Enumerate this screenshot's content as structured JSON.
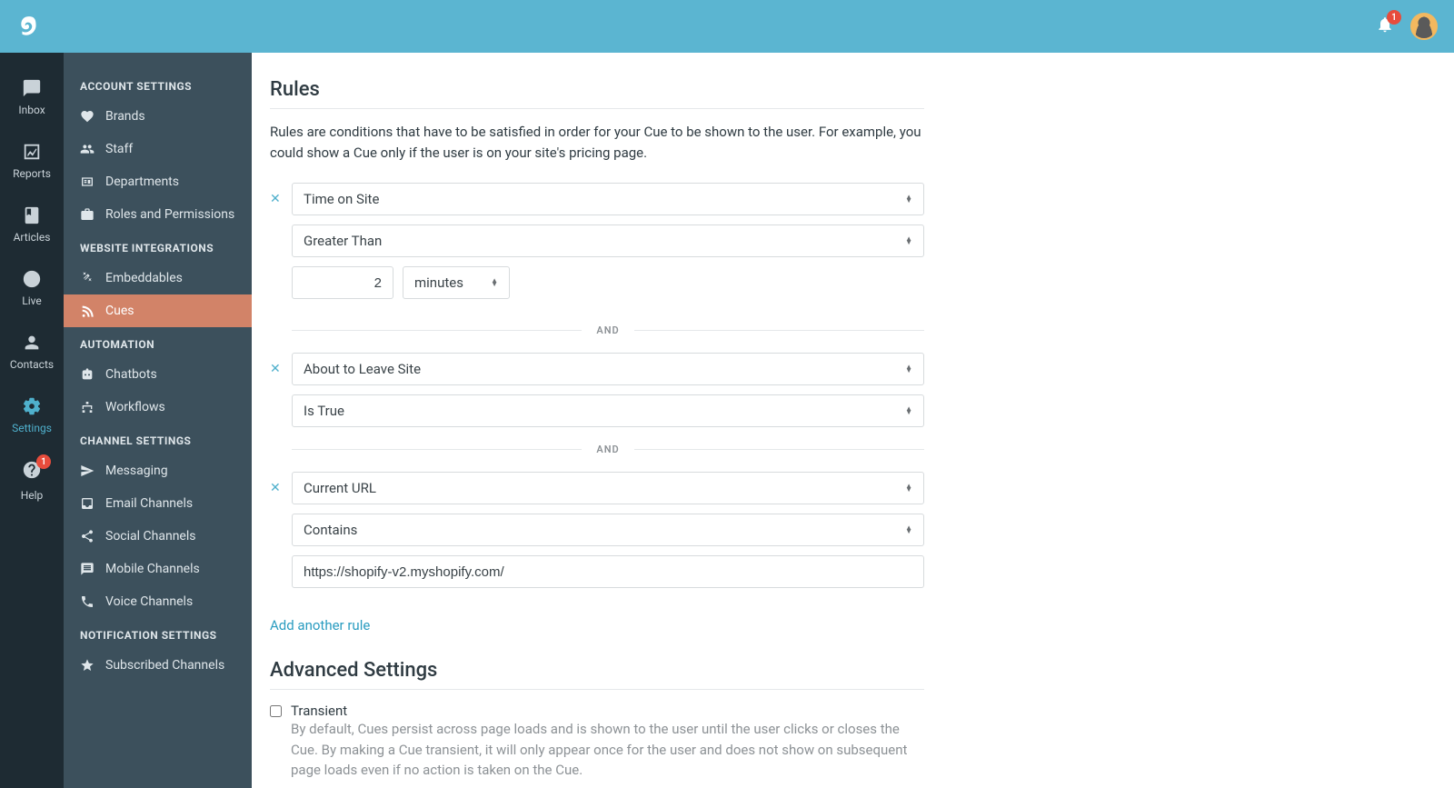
{
  "topbar": {
    "notification_count": "1"
  },
  "rail": {
    "inbox": "Inbox",
    "reports": "Reports",
    "articles": "Articles",
    "live": "Live",
    "contacts": "Contacts",
    "settings": "Settings",
    "help": "Help",
    "help_badge": "1"
  },
  "subnav": {
    "account_settings": "ACCOUNT SETTINGS",
    "brands": "Brands",
    "staff": "Staff",
    "departments": "Departments",
    "roles": "Roles and Permissions",
    "website_integrations": "WEBSITE INTEGRATIONS",
    "embeddables": "Embeddables",
    "cues": "Cues",
    "automation": "AUTOMATION",
    "chatbots": "Chatbots",
    "workflows": "Workflows",
    "channel_settings": "CHANNEL SETTINGS",
    "messaging": "Messaging",
    "email_channels": "Email Channels",
    "social_channels": "Social Channels",
    "mobile_channels": "Mobile Channels",
    "voice_channels": "Voice Channels",
    "notification_settings": "NOTIFICATION SETTINGS",
    "subscribed_channels": "Subscribed Channels"
  },
  "main": {
    "rules_heading": "Rules",
    "rules_desc": "Rules are conditions that have to be satisfied in order for your Cue to be shown to the user. For example, you could show a Cue only if the user is on your site's pricing page.",
    "and_label": "AND",
    "rule1": {
      "field": "Time on Site",
      "op": "Greater Than",
      "value": "2",
      "unit": "minutes"
    },
    "rule2": {
      "field": "About to Leave Site",
      "op": "Is True"
    },
    "rule3": {
      "field": "Current URL",
      "op": "Contains",
      "value": "https://shopify-v2.myshopify.com/"
    },
    "add_rule": "Add another rule",
    "advanced_heading": "Advanced Settings",
    "transient_label": "Transient",
    "transient_desc": "By default, Cues persist across page loads and is shown to the user until the user clicks or closes the Cue. By making a Cue transient, it will only appear once for the user and does not show on subsequent page loads even if no action is taken on the Cue."
  }
}
